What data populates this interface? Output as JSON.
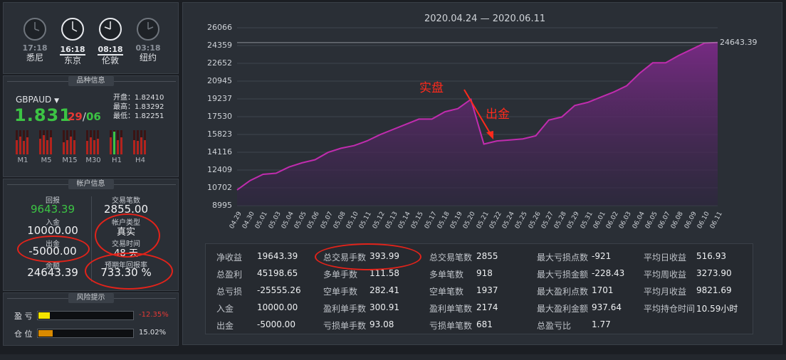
{
  "clocks": [
    {
      "time": "17:18",
      "city": "悉尼",
      "active": false
    },
    {
      "time": "16:18",
      "city": "东京",
      "active": true
    },
    {
      "time": "08:18",
      "city": "伦敦",
      "active": true
    },
    {
      "time": "03:18",
      "city": "纽约",
      "active": false
    }
  ],
  "symbol_section": {
    "title": "品种信息",
    "symbol": "GBPAUD",
    "price_big": "1.831",
    "price_small_a": "29",
    "price_sep": "/",
    "price_small_b": "06",
    "open_label": "开盘：",
    "open": "1.82410",
    "high_label": "最高：",
    "high": "1.83292",
    "low_label": "最低：",
    "low": "1.82251",
    "timeframes": [
      "M1",
      "M5",
      "M15",
      "M30",
      "H1",
      "H4"
    ],
    "bar_levels": [
      [
        0.6,
        0.75,
        0.55,
        0.7
      ],
      [
        0.65,
        0.8,
        0.6,
        0.7
      ],
      [
        0.5,
        0.6,
        0.75,
        0.6
      ],
      [
        0.55,
        0.7,
        0.6,
        0.65
      ],
      [
        0.7,
        0.95,
        0.6,
        0.7
      ],
      [
        0.6,
        0.55,
        0.7,
        0.6
      ]
    ],
    "accent_up": "#3cc444",
    "accent_down": "#e53935"
  },
  "account": {
    "title": "帐户信息",
    "return_label": "回报",
    "return_value": "9643.39",
    "trades_label": "交易笔数",
    "trades_value": "2855.00",
    "deposit_label": "入金",
    "deposit_value": "10000.00",
    "type_label": "帐户类型",
    "type_value": "真实",
    "withdraw_label": "出金",
    "withdraw_value": "-5000.00",
    "time_label": "交易时间",
    "time_value": "48 天",
    "balance_label": "余额",
    "balance_value": "24643.39",
    "annual_label": "预期年回报率",
    "annual_value": "733.30 %"
  },
  "risk": {
    "title": "风险提示",
    "pl_label": "盈 亏",
    "pl_value": "-12.35%",
    "pl_fill": 0.12,
    "pos_label": "仓 位",
    "pos_value": "15.02%",
    "pos_fill": 0.15
  },
  "chart_data": {
    "type": "area",
    "title": "2020.04.24 — 2020.06.11",
    "x": [
      "04.29",
      "04.30",
      "05.01",
      "05.03",
      "05.04",
      "05.05",
      "05.06",
      "05.07",
      "05.08",
      "05.10",
      "05.11",
      "05.12",
      "05.13",
      "05.14",
      "05.15",
      "05.17",
      "05.18",
      "05.19",
      "05.20",
      "05.21",
      "05.22",
      "05.24",
      "05.25",
      "05.26",
      "05.27",
      "05.28",
      "05.29",
      "05.31",
      "06.01",
      "06.02",
      "06.03",
      "06.04",
      "06.05",
      "06.07",
      "06.08",
      "06.09",
      "06.10",
      "06.11"
    ],
    "y": [
      10500,
      11400,
      12000,
      12100,
      12700,
      13100,
      13400,
      14100,
      14500,
      14750,
      15200,
      15800,
      16300,
      16800,
      17300,
      17300,
      18000,
      18300,
      19200,
      14900,
      15200,
      15300,
      15400,
      15700,
      17200,
      17500,
      18600,
      18900,
      19400,
      19900,
      20500,
      21700,
      22700,
      22700,
      23400,
      24000,
      24600,
      24643.39
    ],
    "ylim": [
      8995,
      26066
    ],
    "yticks": [
      "26066",
      "24359",
      "22652",
      "20945",
      "19237",
      "17530",
      "15823",
      "14116",
      "12409",
      "10702",
      "8995"
    ],
    "last_label": "24643.39",
    "line_color": "#c02cae",
    "annotations": [
      "实盘",
      "出金"
    ]
  },
  "stats": [
    [
      {
        "k": "净收益",
        "v": "19643.39"
      },
      {
        "k": "总盈利",
        "v": "45198.65"
      },
      {
        "k": "总亏损",
        "v": "-25555.26"
      },
      {
        "k": "入金",
        "v": "10000.00"
      },
      {
        "k": "出金",
        "v": "-5000.00"
      }
    ],
    [
      {
        "k": "总交易手数",
        "v": "393.99"
      },
      {
        "k": "多单手数",
        "v": "111.58"
      },
      {
        "k": "空单手数",
        "v": "282.41"
      },
      {
        "k": "盈利单手数",
        "v": "300.91"
      },
      {
        "k": "亏损单手数",
        "v": "93.08"
      }
    ],
    [
      {
        "k": "总交易笔数",
        "v": "2855"
      },
      {
        "k": "多单笔数",
        "v": "918"
      },
      {
        "k": "空单笔数",
        "v": "1937"
      },
      {
        "k": "盈利单笔数",
        "v": "2174"
      },
      {
        "k": "亏损单笔数",
        "v": "681"
      }
    ],
    [
      {
        "k": "最大亏损点数",
        "v": "-921"
      },
      {
        "k": "最大亏损金额",
        "v": "-228.43"
      },
      {
        "k": "最大盈利点数",
        "v": "1701"
      },
      {
        "k": "最大盈利金额",
        "v": "937.64"
      },
      {
        "k": "总盈亏比",
        "v": "1.77"
      }
    ],
    [
      {
        "k": "平均日收益",
        "v": "516.93"
      },
      {
        "k": "平均周收益",
        "v": "3273.90"
      },
      {
        "k": "平均月收益",
        "v": "9821.69"
      },
      {
        "k": "平均持仓时间",
        "v": "10.59小时"
      }
    ]
  ]
}
